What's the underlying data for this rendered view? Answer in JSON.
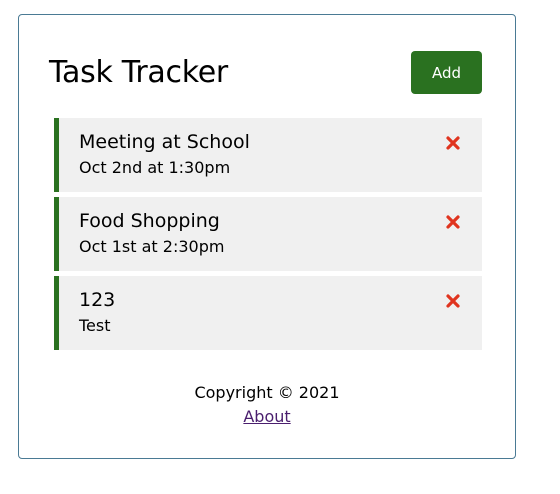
{
  "header": {
    "title": "Task Tracker",
    "add_label": "Add"
  },
  "tasks": [
    {
      "text": "Meeting at School",
      "day": "Oct 2nd at 1:30pm",
      "reminder": true
    },
    {
      "text": "Food Shopping",
      "day": "Oct 1st at 2:30pm",
      "reminder": true
    },
    {
      "text": "123",
      "day": "Test",
      "reminder": true
    }
  ],
  "footer": {
    "copyright": "Copyright © 2021",
    "about_link": "About"
  },
  "colors": {
    "accent_green": "#2a7120",
    "delete_red": "#e0341f",
    "task_bg": "#f0f0f0",
    "border": "#4a7a94",
    "link": "#4a1e6e"
  },
  "icons": {
    "delete": "close-icon"
  }
}
